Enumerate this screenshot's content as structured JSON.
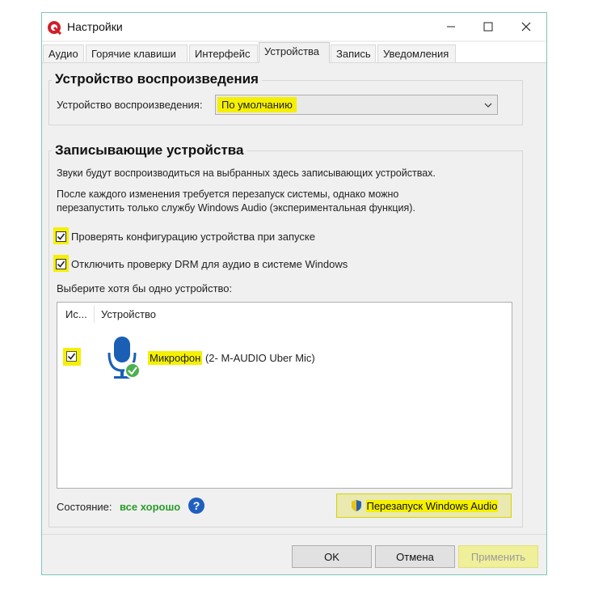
{
  "window": {
    "title": "Настройки"
  },
  "tabs": [
    {
      "label": "Аудио"
    },
    {
      "label": "Горячие клавиши"
    },
    {
      "label": "Интерфейс"
    },
    {
      "label": "Устройства"
    },
    {
      "label": "Запись"
    },
    {
      "label": "Уведомления"
    }
  ],
  "active_tab": "Устройства",
  "playback": {
    "group_title": "Устройство воспроизведения",
    "label": "Устройство воспроизведения:",
    "selected": "По умолчанию"
  },
  "recording": {
    "group_title": "Записывающие устройства",
    "info1": "Звуки будут воспроизводиться на выбранных здесь записывающих устройствах.",
    "info2_line1": "После каждого изменения требуется перезапуск системы, однако можно",
    "info2_line2": "перезапустить только службу Windows Audio (экспериментальная функция).",
    "check1": {
      "label": "Проверять конфигурацию устройства при запуске",
      "checked": true
    },
    "check2": {
      "label": "Отключить проверку DRM для аудио в системе Windows",
      "checked": true
    },
    "select_prompt": "Выберите хотя бы одно устройство:",
    "columns": [
      "Ис...",
      "Устройство"
    ],
    "devices": [
      {
        "name": "Микрофон",
        "detail": "(2- M-AUDIO Uber Mic)",
        "checked": true,
        "icon": "microphone-icon"
      }
    ],
    "status_label": "Состояние:",
    "status_value": "все хорошо",
    "restart_button": "Перезапуск Windows Audio"
  },
  "footer": {
    "ok": "OK",
    "cancel": "Отмена",
    "apply": "Применить"
  },
  "colors": {
    "highlight": "#f5f000",
    "status_ok": "#2a9d2a",
    "help": "#1f5fbf",
    "mic_blue": "#1a5fb4"
  }
}
